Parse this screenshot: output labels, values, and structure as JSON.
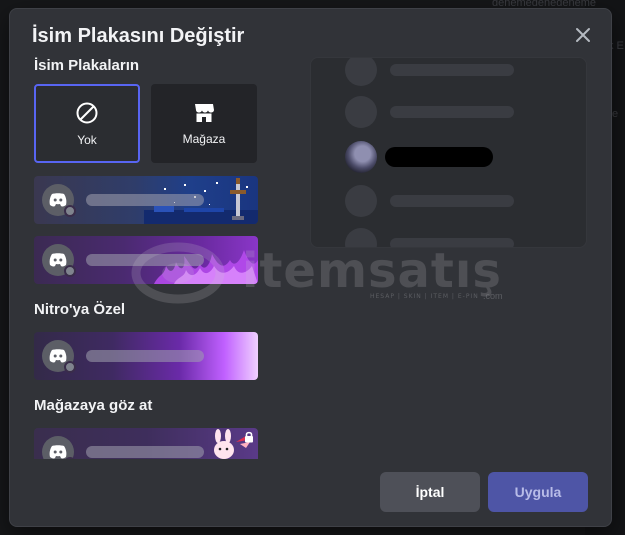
{
  "background": {
    "top_text": "denemedenedeneme",
    "side_text_1": "k E",
    "side_text_2": "e"
  },
  "modal": {
    "title": "İsim Plakasını Değiştir",
    "close_icon": "close-icon"
  },
  "sections": {
    "owned": "İsim Plakaların",
    "nitro": "Nitro'ya Özel",
    "shop": "Mağazaya göz at"
  },
  "tiles": {
    "none_label": "Yok",
    "none_icon": "ban-icon",
    "shop_label": "Mağaza",
    "shop_icon": "shop-icon"
  },
  "plates": [
    {
      "theme": "pixel-night-sword",
      "colors": [
        "#0c1a3a",
        "#2a4a9a"
      ]
    },
    {
      "theme": "purple-flames",
      "colors": [
        "#3a1a5a",
        "#9a2ad0"
      ]
    },
    {
      "theme": "purple-glow",
      "colors": [
        "#3a1a5a",
        "#c060ff"
      ]
    },
    {
      "theme": "bunny-lock",
      "colors": [
        "#2a1a4a",
        "#6a3a9a"
      ],
      "locked": true
    }
  ],
  "buttons": {
    "cancel": "İptal",
    "apply": "Uygula"
  },
  "watermark": {
    "text": "itemsatış",
    "sub": "HESAP | SKIN | ITEM | E-PIN",
    "suffix": ".com"
  },
  "colors": {
    "accent": "#5865f2",
    "apply_bg": "#4e55a6",
    "cancel_bg": "#4e5058",
    "modal_bg": "#313338"
  }
}
